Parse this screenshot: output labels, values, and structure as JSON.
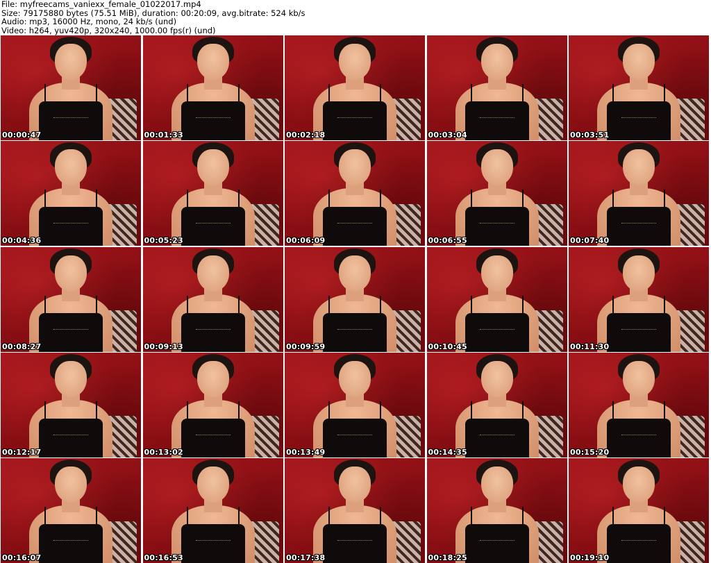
{
  "header": {
    "lines": [
      "File: myfreecams_vaniexx_female_01022017.mp4",
      "Size: 79175880 bytes (75.51 MiB), duration: 00:20:09, avg.bitrate: 524 kb/s",
      "Audio: mp3, 16000 Hz, mono, 24 kb/s (und)",
      "Video: h264, yuv420p, 320x240, 1000.00 fps(r) (und)"
    ]
  },
  "colors": {
    "background": "#ffffff",
    "thumb_red": "#8e1014",
    "timestamp_text": "#ffffff",
    "timestamp_outline": "#000000"
  },
  "thumbnails": [
    {
      "time": "00:00:47"
    },
    {
      "time": "00:01:33"
    },
    {
      "time": "00:02:18"
    },
    {
      "time": "00:03:04"
    },
    {
      "time": "00:03:51"
    },
    {
      "time": "00:04:36"
    },
    {
      "time": "00:05:23"
    },
    {
      "time": "00:06:09"
    },
    {
      "time": "00:06:55"
    },
    {
      "time": "00:07:40"
    },
    {
      "time": "00:08:27"
    },
    {
      "time": "00:09:13"
    },
    {
      "time": "00:09:59"
    },
    {
      "time": "00:10:45"
    },
    {
      "time": "00:11:30"
    },
    {
      "time": "00:12:17"
    },
    {
      "time": "00:13:02"
    },
    {
      "time": "00:13:49"
    },
    {
      "time": "00:14:35"
    },
    {
      "time": "00:15:20"
    },
    {
      "time": "00:16:07"
    },
    {
      "time": "00:16:53"
    },
    {
      "time": "00:17:38"
    },
    {
      "time": "00:18:25"
    },
    {
      "time": "00:19:10"
    }
  ]
}
